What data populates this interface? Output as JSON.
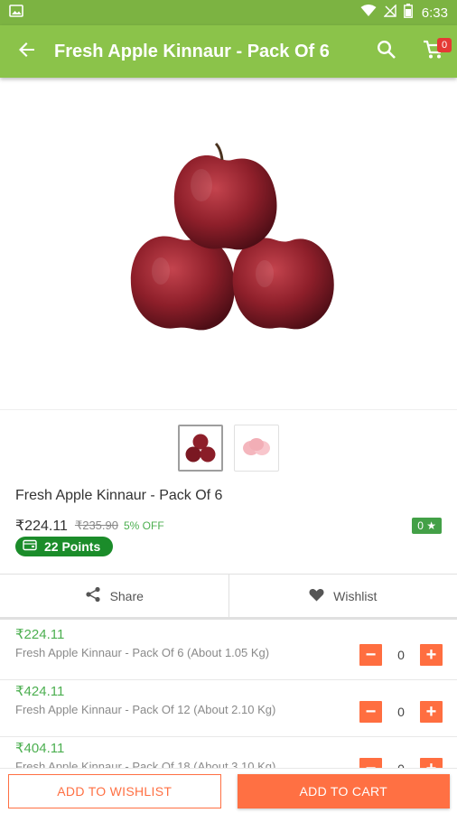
{
  "status_bar": {
    "time": "6:33",
    "icons": [
      "image-notification-icon",
      "wifi-icon",
      "no-signal-icon",
      "battery-icon"
    ]
  },
  "app_bar": {
    "title": "Fresh Apple Kinnaur - Pack Of 6",
    "cart_count": "0",
    "color": "#8bc34a"
  },
  "product": {
    "name": "Fresh Apple Kinnaur - Pack Of 6",
    "price": "₹224.11",
    "mrp": "₹235.90",
    "discount": "5% OFF",
    "rating": "0 ★",
    "points": "22 Points",
    "thumbnails": [
      "red-apples-thumbnail",
      "peeled-apples-thumbnail"
    ]
  },
  "actions": {
    "share_label": "Share",
    "wishlist_label": "Wishlist"
  },
  "variants": [
    {
      "price": "₹224.11",
      "name": "Fresh Apple Kinnaur - Pack Of 6 (About 1.05 Kg)",
      "qty": "0"
    },
    {
      "price": "₹424.11",
      "name": "Fresh Apple Kinnaur - Pack Of 12 (About 2.10 Kg)",
      "qty": "0"
    },
    {
      "price": "₹404.11",
      "name": "Fresh Apple Kinnaur - Pack Of 18 (About 3.10 Kg)",
      "qty": "0"
    }
  ],
  "qty_minus_symbol": "−",
  "qty_plus_symbol": "+",
  "bottom": {
    "wishlist_label": "ADD TO WISHLIST",
    "cart_label": "ADD TO CART"
  },
  "colors": {
    "primary": "#8bc34a",
    "status_bar": "#7cb342",
    "accent": "#ff7043",
    "price_green": "#4caf50",
    "points_green": "#1b8c2a",
    "badge_red": "#e53935"
  }
}
